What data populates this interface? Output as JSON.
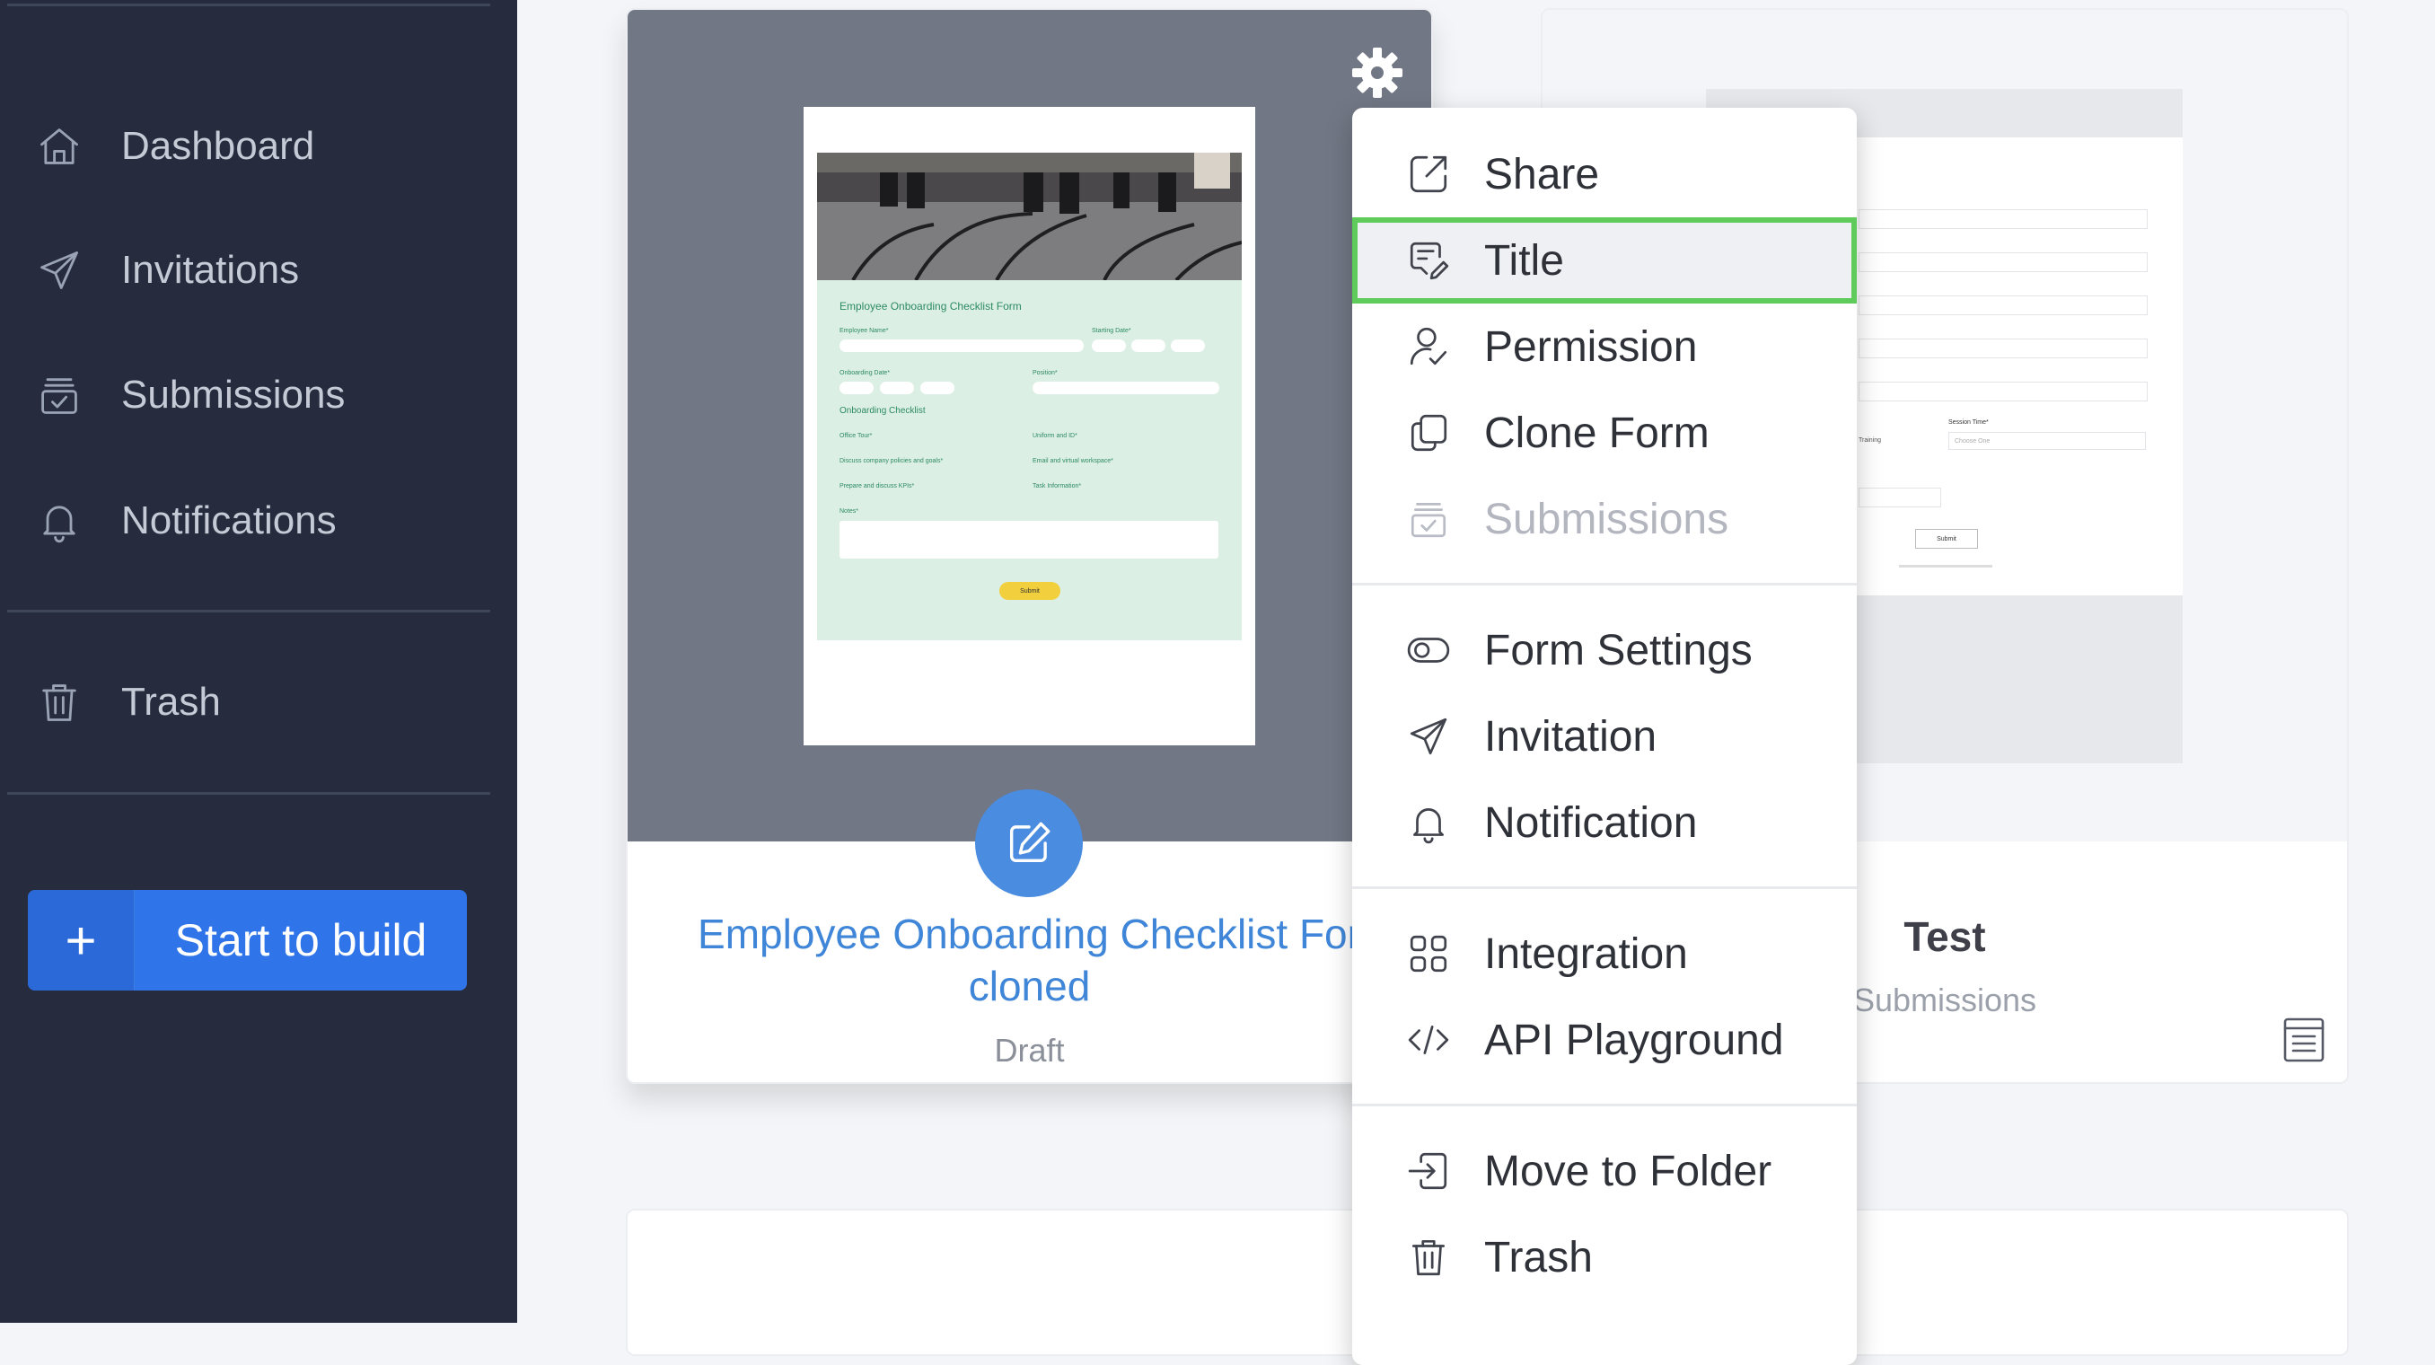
{
  "sidebar": {
    "items": [
      {
        "label": "Dashboard",
        "icon": "home-icon"
      },
      {
        "label": "Invitations",
        "icon": "paper-plane-icon"
      },
      {
        "label": "Submissions",
        "icon": "inbox-check-icon"
      },
      {
        "label": "Notifications",
        "icon": "bell-icon"
      },
      {
        "label": "Trash",
        "icon": "trash-icon"
      }
    ],
    "build_button": {
      "plus": "+",
      "label": "Start to build"
    }
  },
  "cards": [
    {
      "title_line1": "Employee Onboarding Checklist For",
      "title_line2": "cloned",
      "status": "Draft",
      "preview": {
        "form_title": "Employee Onboarding Checklist Form",
        "labels": [
          "Employee Name*",
          "Starting Date*",
          "Onboarding Date*",
          "Position*"
        ],
        "section": "Onboarding Checklist",
        "tasks": [
          "Office Tour*",
          "Uniform and ID*",
          "Discuss company policies and goals*",
          "Email and virtual workspace*",
          "Prepare and discuss KPIs*",
          "Task Information*"
        ],
        "notes": "Notes*",
        "submit": "Submit"
      }
    },
    {
      "title": "Test",
      "subtitle": "Submissions",
      "preview": {
        "session_label": "Session Time*",
        "choose": "Choose One",
        "training": "Training",
        "submit": "Submit"
      }
    }
  ],
  "context_menu": {
    "groups": [
      [
        {
          "label": "Share",
          "icon": "share-icon",
          "state": "normal"
        },
        {
          "label": "Title",
          "icon": "title-edit-icon",
          "state": "selected"
        },
        {
          "label": "Permission",
          "icon": "user-check-icon",
          "state": "normal"
        },
        {
          "label": "Clone Form",
          "icon": "clone-icon",
          "state": "normal"
        },
        {
          "label": "Submissions",
          "icon": "inbox-check-icon",
          "state": "disabled"
        }
      ],
      [
        {
          "label": "Form Settings",
          "icon": "toggle-icon",
          "state": "normal"
        },
        {
          "label": "Invitation",
          "icon": "paper-plane-icon",
          "state": "normal"
        },
        {
          "label": "Notification",
          "icon": "bell-icon",
          "state": "normal"
        }
      ],
      [
        {
          "label": "Integration",
          "icon": "grid-icon",
          "state": "normal"
        },
        {
          "label": "API Playground",
          "icon": "code-icon",
          "state": "normal"
        }
      ],
      [
        {
          "label": "Move to Folder",
          "icon": "move-folder-icon",
          "state": "normal"
        },
        {
          "label": "Trash",
          "icon": "trash-icon",
          "state": "normal"
        }
      ]
    ]
  },
  "colors": {
    "sidebar": "#262c3d",
    "accent": "#2f74e8",
    "selection_outline": "#5ecb5a",
    "link": "#3f86d9"
  }
}
